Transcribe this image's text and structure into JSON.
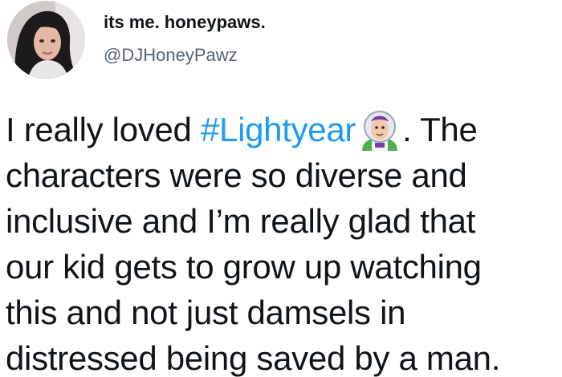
{
  "author": {
    "display_name": "its me. honeypaws.",
    "handle": "@DJHoneyPawz"
  },
  "tweet": {
    "line1_before": "I really loved ",
    "hashtag": "#Lightyear",
    "emoji_icon": "buzz-lightyear-emoji",
    "line1_after": ". The",
    "lines": [
      "characters were so diverse and",
      "inclusive and I’m really glad that",
      "our kid gets to grow up watching",
      "this and not just damsels in",
      "distressed being saved by a man."
    ]
  },
  "colors": {
    "text": "#0f1419",
    "secondary": "#536471",
    "link": "#1d9bf0",
    "background": "#ffffff"
  }
}
